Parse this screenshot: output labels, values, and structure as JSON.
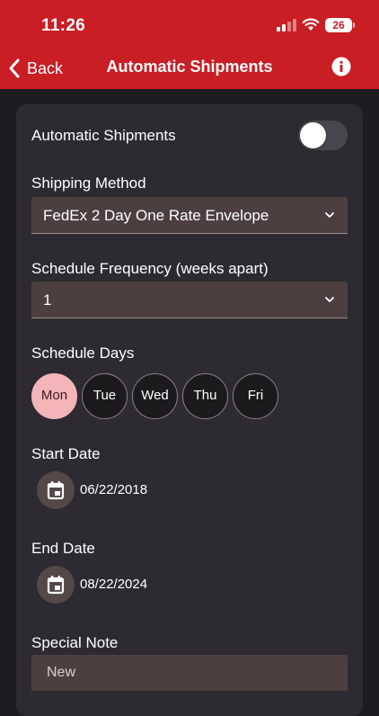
{
  "status_bar": {
    "time": "11:26",
    "battery": "26"
  },
  "nav": {
    "back_label": "Back",
    "title": "Automatic Shipments",
    "icons": [
      "chevron-left-icon",
      "info-icon"
    ]
  },
  "form": {
    "auto_shipments": {
      "label": "Automatic Shipments",
      "enabled": false
    },
    "shipping_method": {
      "label": "Shipping Method",
      "value": "FedEx 2 Day One Rate Envelope"
    },
    "frequency": {
      "label": "Schedule Frequency (weeks apart)",
      "value": "1"
    },
    "schedule_days": {
      "label": "Schedule Days",
      "days": [
        "Mon",
        "Tue",
        "Wed",
        "Thu",
        "Fri"
      ],
      "selected": [
        "Mon"
      ]
    },
    "start_date": {
      "label": "Start Date",
      "value": "06/22/2018"
    },
    "end_date": {
      "label": "End Date",
      "value": "08/22/2024"
    },
    "special_note": {
      "label": "Special Note",
      "placeholder": "New"
    }
  },
  "colors": {
    "header": "#c91e24",
    "background": "#1e1c20",
    "card": "#2d2b31",
    "field": "#4d3f3f",
    "selected_day": "#f4b5b9"
  }
}
